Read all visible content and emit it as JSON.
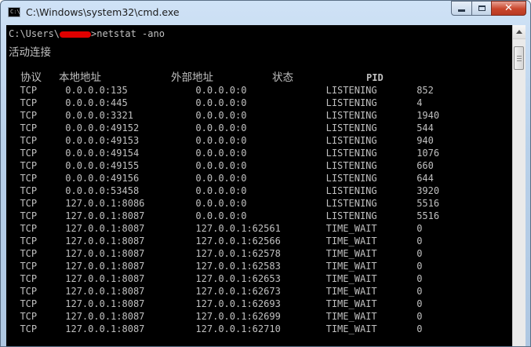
{
  "window": {
    "title": "C:\\Windows\\system32\\cmd.exe",
    "icon": "console-app-icon",
    "icon_text": "C:\\",
    "buttons": {
      "minimize": "minimize-icon",
      "maximize": "maximize-icon",
      "close": "✕"
    }
  },
  "console": {
    "prompt_prefix": "C:\\Users\\",
    "prompt_suffix": ">netstat -ano",
    "section_title": "活动连接",
    "headers": [
      "协议",
      "本地地址",
      "外部地址",
      "状态",
      "PID"
    ],
    "rows": [
      [
        "TCP",
        "0.0.0.0:135",
        "0.0.0.0:0",
        "LISTENING",
        "852"
      ],
      [
        "TCP",
        "0.0.0.0:445",
        "0.0.0.0:0",
        "LISTENING",
        "4"
      ],
      [
        "TCP",
        "0.0.0.0:3321",
        "0.0.0.0:0",
        "LISTENING",
        "1940"
      ],
      [
        "TCP",
        "0.0.0.0:49152",
        "0.0.0.0:0",
        "LISTENING",
        "544"
      ],
      [
        "TCP",
        "0.0.0.0:49153",
        "0.0.0.0:0",
        "LISTENING",
        "940"
      ],
      [
        "TCP",
        "0.0.0.0:49154",
        "0.0.0.0:0",
        "LISTENING",
        "1076"
      ],
      [
        "TCP",
        "0.0.0.0:49155",
        "0.0.0.0:0",
        "LISTENING",
        "660"
      ],
      [
        "TCP",
        "0.0.0.0:49156",
        "0.0.0.0:0",
        "LISTENING",
        "644"
      ],
      [
        "TCP",
        "0.0.0.0:53458",
        "0.0.0.0:0",
        "LISTENING",
        "3920"
      ],
      [
        "TCP",
        "127.0.0.1:8086",
        "0.0.0.0:0",
        "LISTENING",
        "5516"
      ],
      [
        "TCP",
        "127.0.0.1:8087",
        "0.0.0.0:0",
        "LISTENING",
        "5516"
      ],
      [
        "TCP",
        "127.0.0.1:8087",
        "127.0.0.1:62561",
        "TIME_WAIT",
        "0"
      ],
      [
        "TCP",
        "127.0.0.1:8087",
        "127.0.0.1:62566",
        "TIME_WAIT",
        "0"
      ],
      [
        "TCP",
        "127.0.0.1:8087",
        "127.0.0.1:62578",
        "TIME_WAIT",
        "0"
      ],
      [
        "TCP",
        "127.0.0.1:8087",
        "127.0.0.1:62583",
        "TIME_WAIT",
        "0"
      ],
      [
        "TCP",
        "127.0.0.1:8087",
        "127.0.0.1:62653",
        "TIME_WAIT",
        "0"
      ],
      [
        "TCP",
        "127.0.0.1:8087",
        "127.0.0.1:62673",
        "TIME_WAIT",
        "0"
      ],
      [
        "TCP",
        "127.0.0.1:8087",
        "127.0.0.1:62693",
        "TIME_WAIT",
        "0"
      ],
      [
        "TCP",
        "127.0.0.1:8087",
        "127.0.0.1:62699",
        "TIME_WAIT",
        "0"
      ],
      [
        "TCP",
        "127.0.0.1:8087",
        "127.0.0.1:62710",
        "TIME_WAIT",
        "0"
      ]
    ]
  },
  "colors": {
    "console_bg": "#000000",
    "console_text": "#c0c0c0",
    "redaction": "#e00000"
  }
}
